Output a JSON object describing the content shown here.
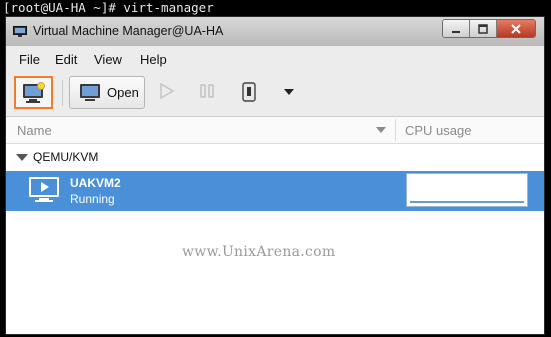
{
  "terminal": {
    "prompt_line": "[root@UA-HA ~]# virt-manager"
  },
  "window": {
    "title": "Virtual Machine Manager@UA-HA",
    "accent": "#4a90d9",
    "highlight_border": "#f07d2c"
  },
  "menubar": {
    "items": [
      "File",
      "Edit",
      "View",
      "Help"
    ]
  },
  "toolbar": {
    "new_icon": "new-vm-icon",
    "open_label": "Open",
    "run_icon": "play-icon",
    "pause_icon": "pause-icon",
    "shutdown_icon": "power-icon",
    "dropdown_icon": "chevron-down-icon"
  },
  "list": {
    "columns": {
      "name": "Name",
      "cpu": "CPU usage"
    },
    "group": {
      "label": "QEMU/KVM"
    },
    "vms": [
      {
        "name": "UAKVM2",
        "status": "Running",
        "cpu_usage": 0
      }
    ]
  },
  "watermark": {
    "text": "www.UnixArena.com"
  }
}
